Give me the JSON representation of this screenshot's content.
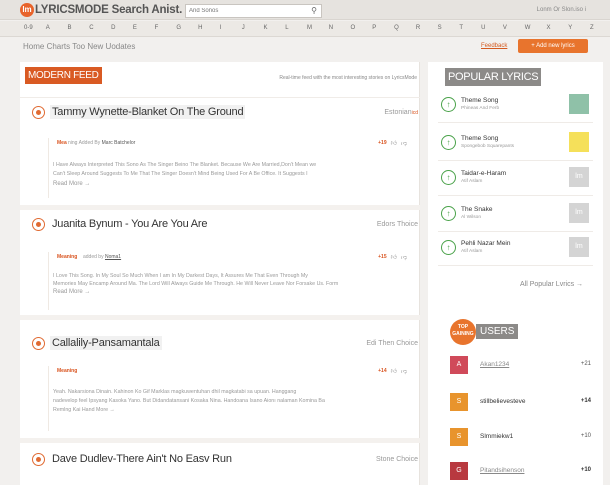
{
  "header": {
    "logo_icon": "lm",
    "logo_text": "LYRICSMODE Search Anist. About",
    "search_placeholder": "And Sonos",
    "login": "Lonm Or Slon.iso i"
  },
  "alphabet": [
    "0-9",
    "A",
    "B",
    "C",
    "D",
    "E",
    "F",
    "G",
    "H",
    "I",
    "J",
    "K",
    "L",
    "M",
    "N",
    "O",
    "P",
    "Q",
    "R",
    "S",
    "T",
    "U",
    "V",
    "W",
    "X",
    "Y",
    "Z"
  ],
  "nav": {
    "links": "Home Charts Too New Uodates",
    "feedback": "Feedback",
    "add_lyrics": "+ Add new lyrics"
  },
  "feed": {
    "title": "MODERN FEED",
    "subtitle": "Real-time feed with the most interesting stories on LyricsMode",
    "items": [
      {
        "song": "Tammy Wynette-Blanket On The Ground",
        "lang": "Estonian",
        "lang_tag": "icd",
        "meaning_label": "Mea",
        "added_by_label": "ning Added By",
        "added_by": "Marc Batchelor",
        "score": "+19",
        "text1": "I Have Always Interpreted This Sono As The Singer Beino The Blanket. Because We Are Married,Don't Mean we",
        "text2": "Can't Sleep Around Suggests To Me That The Singer Doesn't Mind Being Used For A Be Office. It Suggests I",
        "readmore": "Read More →"
      },
      {
        "song": "Juanita Bynum - You Are You Are",
        "lang": "Edors Thoice",
        "lang_tag": "",
        "meaning_label": "Meaning",
        "added_by_label": "added by",
        "added_by": "Noma1",
        "score": "+15",
        "text1": "I Love This Song. In My Soul So Much When I am In My Darkest Days, It Assures Me That Even Through My",
        "text2": "Memories May Encamp Around Ma. The Lord Will Always Guide Me Through. He Will Never Leave Nor Forsake Us. Form",
        "readmore": "Read More →"
      },
      {
        "song": "Callalily-Pansamantala",
        "lang": "Edi Then Choice",
        "lang_tag": "",
        "meaning_label": "Meaning",
        "added_by_label": "",
        "added_by": "",
        "score": "+14",
        "text1": "Yeah. Nakarsiona Dinain. Kahinon Ko Gif Marklas magkuwentuhan dhil magkatabi sa upuan. Hanggang",
        "text2": "nadevelop feel Ipsyang Kasoka Yano. But Didandatansani Kosaka Nina. Handoana Isano Aionı nalaman Komina Ba",
        "text3": "Remlng Kai Hand More →",
        "readmore": ""
      },
      {
        "song": "Dave Dudlev-There Ain't No Easv Run",
        "lang": "Stone Choice",
        "lang_tag": ""
      }
    ]
  },
  "popular": {
    "title": "POPULAR LYRICS",
    "items": [
      {
        "title": "Theme Song",
        "artist": "Phineas And Ferb",
        "thumb": ""
      },
      {
        "title": "Theme Song",
        "artist": "Spongebob Squarepants",
        "thumb": ""
      },
      {
        "title": "Taidar-e-Haram",
        "artist": "Atif Aslam",
        "thumb": "lm"
      },
      {
        "title": "The Snake",
        "artist": "Al Wilson",
        "thumb": "lm"
      },
      {
        "title": "Pehli Nazar Mein",
        "artist": "Atif Aslam",
        "thumb": "lm"
      }
    ],
    "all_link": "All Popular Lvrics →"
  },
  "users": {
    "badge": "TOP GAINING",
    "title": "USERS",
    "items": [
      {
        "initial": "A",
        "name": "Akan1234",
        "score": "+21",
        "color": "#d04a5a"
      },
      {
        "initial": "S",
        "name": "stillbelievesteve",
        "score": "+14",
        "color": "#e8942d"
      },
      {
        "initial": "S",
        "name": "Slmmiekw1",
        "score": "+10",
        "color": "#e8942d"
      },
      {
        "initial": "G",
        "name": "Pitandsihenson",
        "score": "+10",
        "color": "#b8393f"
      }
    ]
  },
  "colors": {
    "accent": "#e8742d",
    "badge_gray": "#8c8a88",
    "up_green": "#4aa24a"
  }
}
